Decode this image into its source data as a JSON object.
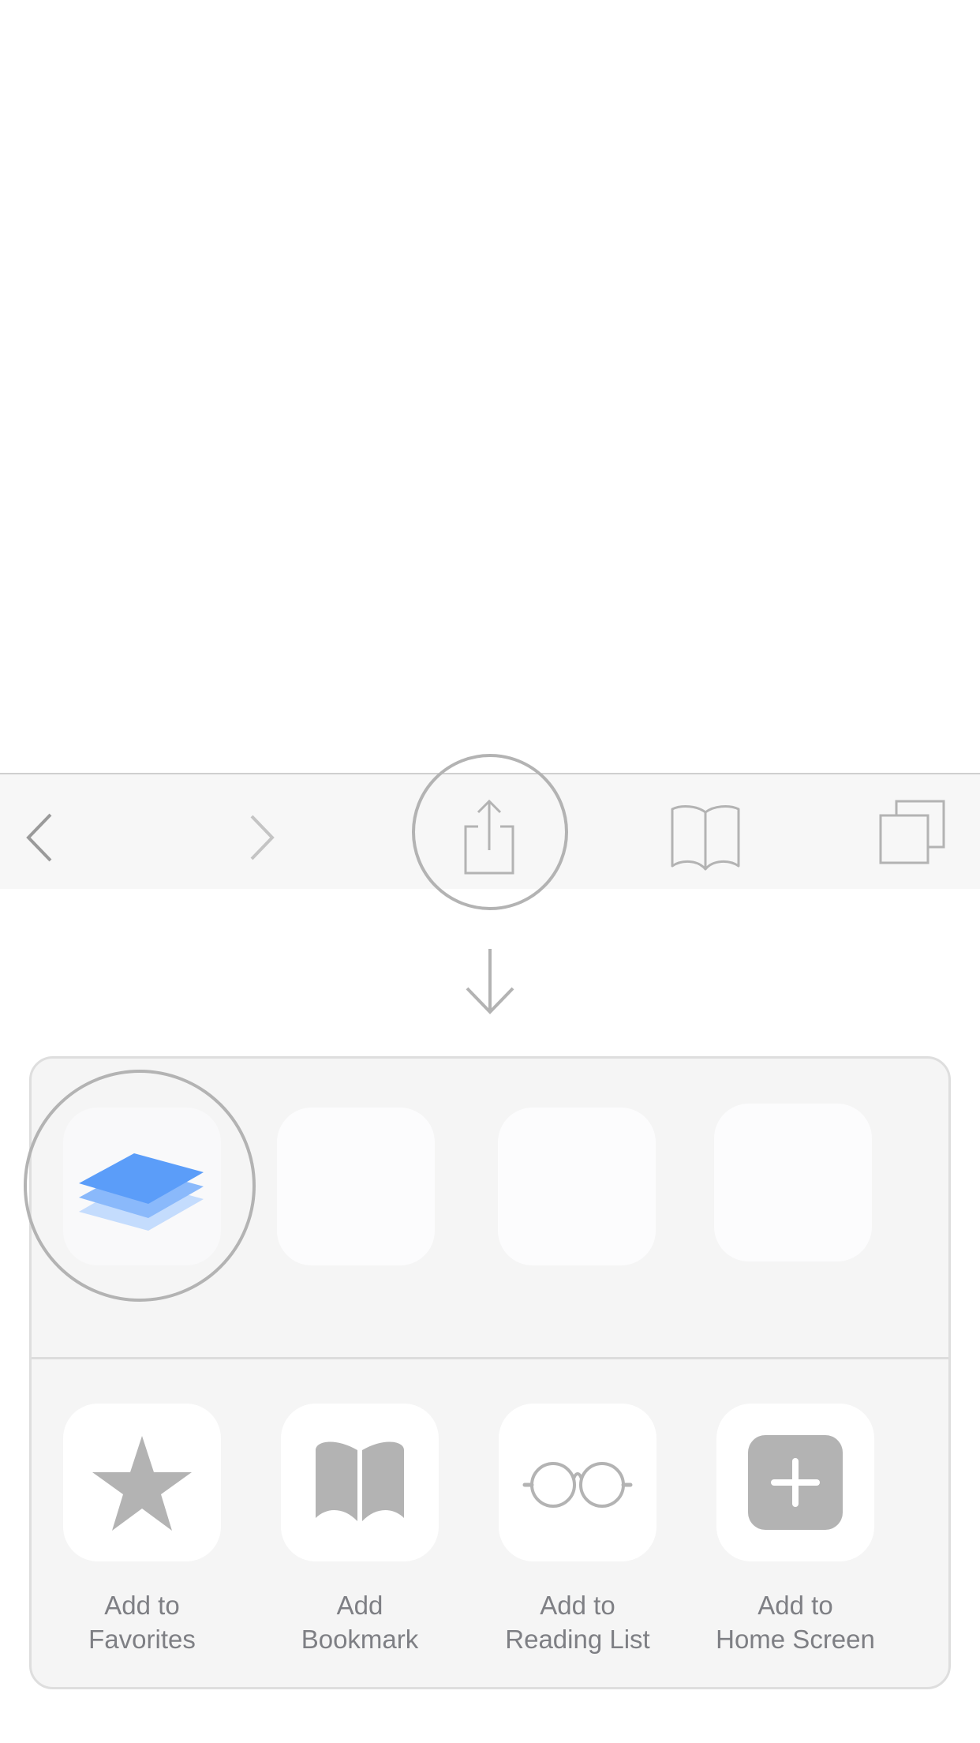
{
  "toolbar": {
    "items": [
      {
        "name": "back",
        "icon": "chevron-left-icon"
      },
      {
        "name": "forward",
        "icon": "chevron-right-icon"
      },
      {
        "name": "share",
        "icon": "share-icon"
      },
      {
        "name": "bookmarks",
        "icon": "book-icon"
      },
      {
        "name": "tabs",
        "icon": "tabs-icon"
      }
    ]
  },
  "share_sheet": {
    "apps": [
      {
        "icon": "layers-icon",
        "accent": "#5b9df9"
      },
      {
        "icon": ""
      },
      {
        "icon": ""
      },
      {
        "icon": ""
      }
    ],
    "actions": [
      {
        "label": "Add to\nFavorites",
        "icon": "star-icon"
      },
      {
        "label": "Add\nBookmark",
        "icon": "book-icon"
      },
      {
        "label": "Add to\nReading List",
        "icon": "glasses-icon"
      },
      {
        "label": "Add to\nHome Screen",
        "icon": "plus-square-icon"
      }
    ]
  },
  "colors": {
    "icon_gray": "#b3b3b3",
    "label_gray": "#7e7f84",
    "layers_blue": "#5b9df9"
  }
}
